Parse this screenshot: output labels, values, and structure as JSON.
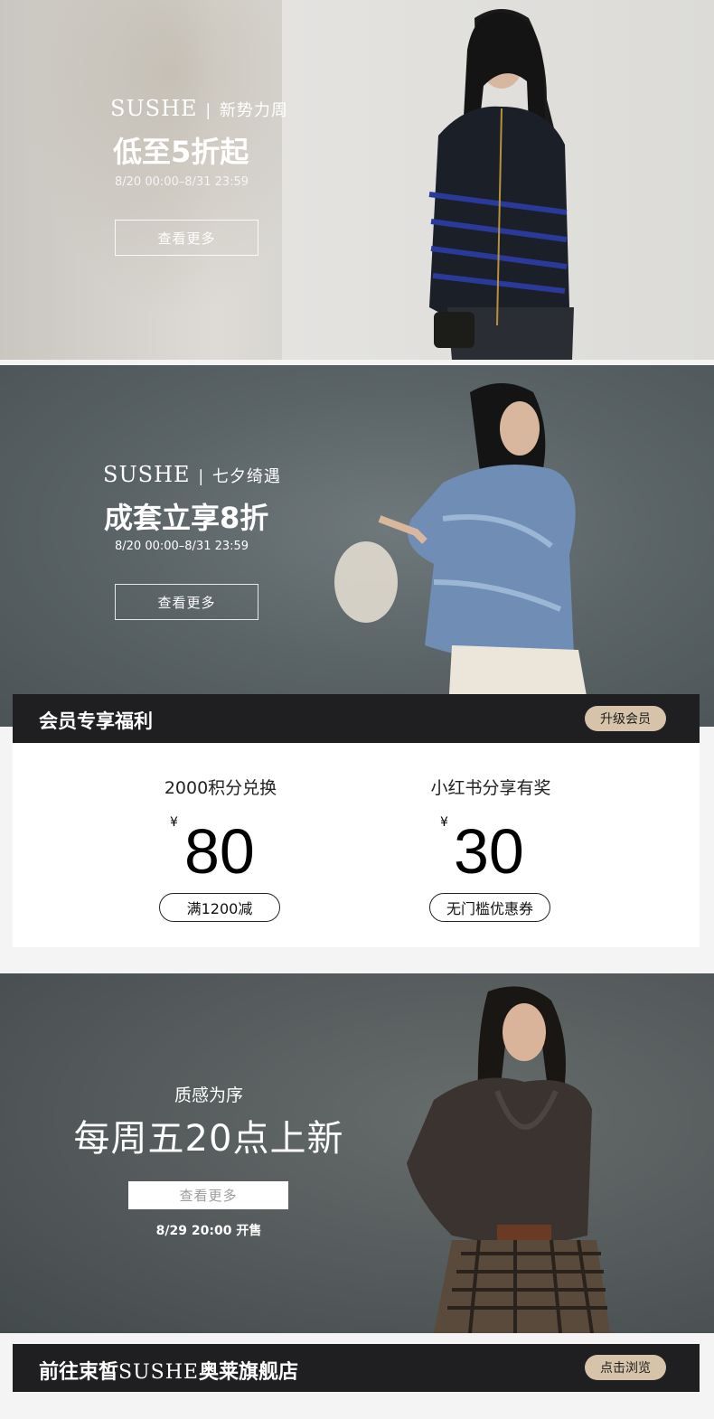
{
  "banner1": {
    "brand": "SUSHE",
    "divider": "|",
    "campaign": "新势力周",
    "headline": "低至5折起",
    "dates": "8/20 00:00–8/31 23:59",
    "button": "查看更多"
  },
  "banner2": {
    "brand": "SUSHE",
    "divider": "|",
    "campaign": "七夕绮遇",
    "headline": "成套立享8折",
    "dates": "8/20 00:00–8/31 23:59",
    "button": "查看更多"
  },
  "member": {
    "title": "会员专享福利",
    "upgrade": "升级会员",
    "coupons": [
      {
        "title": "2000积分兑换",
        "currency": "¥",
        "amount": "80",
        "condition": "满1200减"
      },
      {
        "title": "小红书分享有奖",
        "currency": "¥",
        "amount": "30",
        "condition": "无门槛优惠券"
      }
    ]
  },
  "banner3": {
    "subtitle": "质感为序",
    "headline": "每周五20点上新",
    "button": "查看更多",
    "release": "8/29 20:00 开售"
  },
  "store": {
    "prefix": "前往束皙",
    "brand": "SUSHE",
    "suffix": "奥莱旗舰店",
    "browse": "点击浏览"
  },
  "colors": {
    "dark_bar": "#1f1f22",
    "pill": "#d7c3aa"
  }
}
